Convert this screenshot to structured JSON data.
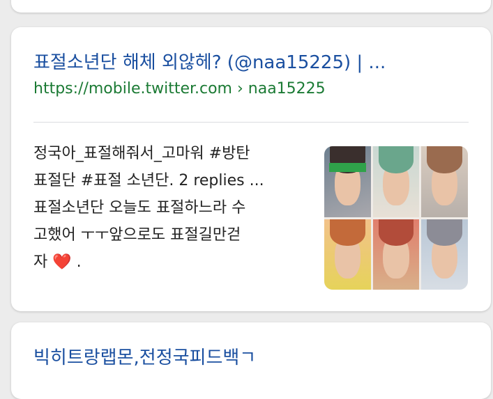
{
  "results": [
    {
      "title": "표절소년단 해체 외않헤? (@naa15225) | ...",
      "url": "https://mobile.twitter.com › naa15225",
      "snippet_lines": [
        "정국아_표절해줘서_고마워 #방탄",
        "표절단 #표절 소년단. 2 replies ...",
        "표절소년단 오늘도 표절하느라 수",
        "고했어 ㅜㅜ앞으로도 표절길만걷",
        "자"
      ],
      "snippet_tail": " .",
      "heart": "❤️",
      "thumbnail_icon": "photo-collage-icon"
    },
    {
      "title": "빅히트랑랩몬,전정국피드백ㄱ"
    }
  ]
}
